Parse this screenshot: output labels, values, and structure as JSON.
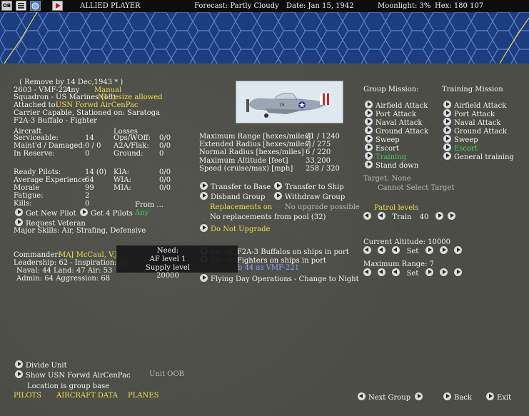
{
  "topbar": {
    "title": "ALLIED PLAYER",
    "forecast": "Forecast: Partly Cloudy",
    "date": "Date: Jan 15, 1942",
    "moonlight": "Moonlight: 3%",
    "hex": "Hex: 180  107",
    "btn_ob": "OB"
  },
  "unit": {
    "remove": "( Remove by 14 Dec,1943 * )",
    "id": "2603 - VMF-221",
    "any": "Any",
    "manual": "Manual",
    "squadron": "Squadron - US Marines (18)",
    "no_resize": "No resize allowed",
    "attached_label": "Attached to:",
    "attached_value": "USN Forwd AirCenPac",
    "carrier": "Carrier Capable, Stationed on: Saratoga",
    "aircraft_type": "F2A-3 Buffalo - Fighter"
  },
  "aircraft": {
    "header": "Aircraft",
    "serviceable_label": "Serviceable:",
    "serviceable": "14",
    "maintd_label": "Maint'd / Damaged:",
    "maintd": "0 / 0",
    "reserve_label": "In Reserve:",
    "reserve": "0"
  },
  "losses": {
    "header": "Losses",
    "ops_label": "Ops/WOff:",
    "ops": "0/0",
    "a2a_label": "A2A/Flak:",
    "a2a": "0/0",
    "ground_label": "Ground:",
    "ground": "0"
  },
  "pilots": {
    "ready_label": "Ready Pilots:",
    "ready": "14 (0)",
    "exp_label": "Average Experience",
    "exp": "64",
    "morale_label": "Morale",
    "morale": "99",
    "fatigue_label": "Fatigue:",
    "fatigue": "2",
    "kills_label": "Kills:",
    "kills": "0",
    "kia_label": "KIA:",
    "kia": "0/0",
    "wia_label": "WIA:",
    "wia": "0/0",
    "mia_label": "MIA:",
    "mia": "0/0",
    "get_new": "Get New Pilot",
    "get_4": "Get 4 Pilots",
    "from_label": "From ...",
    "from_value": "Any",
    "request_vet": "Request Veteran",
    "major_skills": "Major Skills:  Air, Strafing, Defensive"
  },
  "commander": {
    "label": "Commander:",
    "name": "MAJ McCaul, V.J.",
    "leadership": "Leadership: 62 - Inspiration: 56",
    "naval": "Naval:  44   Land:  47   Air:  53",
    "admin": "Admin:  64   Aggression:  68"
  },
  "tooltip": {
    "need": "Need:",
    "af_level": "AF level 1",
    "supply": "Supply level 20000"
  },
  "stats": {
    "max_range_label": "Maximum Range [hexes/miles]",
    "max_range": "31 / 1240",
    "ext_radius_label": "Extended Radius [hexes/miles]",
    "ext_radius": "7 / 275",
    "norm_radius_label": "Normal Radius [hexes/miles]",
    "norm_radius": "6 / 220",
    "max_alt_label": "Maximum Altitude [feet]",
    "max_alt": "33,200",
    "speed_label": "Speed (cruise/max) [mph]",
    "speed": "258 / 320"
  },
  "actions": {
    "transfer_base": "Transfer to Base",
    "transfer_ship": "Transfer to Ship",
    "disband": "Disband Group",
    "withdraw": "Withdraw Group",
    "replacements_on": "Replacements on",
    "no_upgrade": "No upgrade possible",
    "no_replacements": "No replacements from pool (32)",
    "do_not_upgrade": "Do Not Upgrade",
    "set_all_ships": "Set All F2A-3 Buffalos on ships in port",
    "set_all_fighters": "Set All Fighters on ships in port",
    "return_in": "Unit return in Feb 44 as VMF-221",
    "flying_day": "Flying Day Operations - Change to Night"
  },
  "group_mission": {
    "header": "Group Mission:",
    "items": [
      "Airfield Attack",
      "Port Attack",
      "Naval Attack",
      "Ground Attack",
      "Sweep",
      "Escort",
      "Training",
      "Stand down"
    ]
  },
  "training_mission": {
    "header": "Training Mission",
    "items": [
      "Airfield Attack",
      "Port Attack",
      "Naval Attack",
      "Ground Attack",
      "Sweep",
      "Escort",
      "General training"
    ]
  },
  "target": {
    "line": "Target: None",
    "cannot": "Cannot Select Target"
  },
  "patrol": {
    "header": "Patrol levels",
    "train_label": "Train",
    "train_value": "40"
  },
  "altitude": {
    "label": "Current Altitude: 10000",
    "set": "Set"
  },
  "max_range_ctl": {
    "label": "Maximum Range: 7",
    "set": "Set"
  },
  "bottom": {
    "divide": "Divide Unit",
    "show": "Show USN Forwd AirCenPac",
    "unit_oob": "Unit OOB",
    "location": "Location is group base",
    "pilots": "PILOTS",
    "aircraft_data": "AIRCRAFT DATA",
    "planes": "PLANES",
    "next_group": "Next Group",
    "back": "Back",
    "exit": "Exit"
  },
  "colors": {
    "yellow": "#f2dc4a",
    "green": "#37d44a",
    "sea": "#1c3e80",
    "panel": "#4d4d47"
  }
}
